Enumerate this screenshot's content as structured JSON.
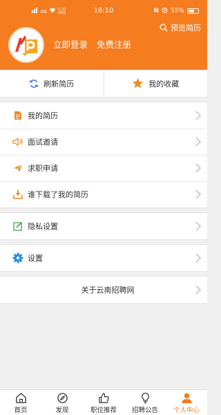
{
  "status_bar": {
    "time": "16:10",
    "net_speed": "0.10 KB/S",
    "signal_label": "4G",
    "nfc": "N",
    "battery": "55%"
  },
  "header": {
    "preview_label": "预览简历",
    "login_label": "立即登录",
    "register_label": "免费注册",
    "colors": {
      "brand": "#f57c1f"
    }
  },
  "quick_actions": {
    "refresh_label": "刷新简历",
    "favorites_label": "我的收藏"
  },
  "menu_group_1": [
    {
      "label": "我的简历",
      "icon": "resume-icon"
    },
    {
      "label": "面试邀请",
      "icon": "speaker-icon"
    },
    {
      "label": "求职申请",
      "icon": "send-icon"
    },
    {
      "label": "谁下载了我的简历",
      "icon": "download-icon"
    }
  ],
  "menu_group_2": [
    {
      "label": "隐私设置",
      "icon": "edit-icon"
    }
  ],
  "menu_group_3": [
    {
      "label": "设置",
      "icon": "gear-icon"
    }
  ],
  "menu_group_4": [
    {
      "label": "关于云南招聘网"
    }
  ],
  "tabs": [
    {
      "label": "首页",
      "icon": "home-icon",
      "active": false
    },
    {
      "label": "发现",
      "icon": "compass-icon",
      "active": false
    },
    {
      "label": "职位推荐",
      "icon": "thumbs-up-icon",
      "active": false
    },
    {
      "label": "招聘公告",
      "icon": "bulb-icon",
      "active": false
    },
    {
      "label": "个人中心",
      "icon": "user-icon",
      "active": true
    }
  ]
}
